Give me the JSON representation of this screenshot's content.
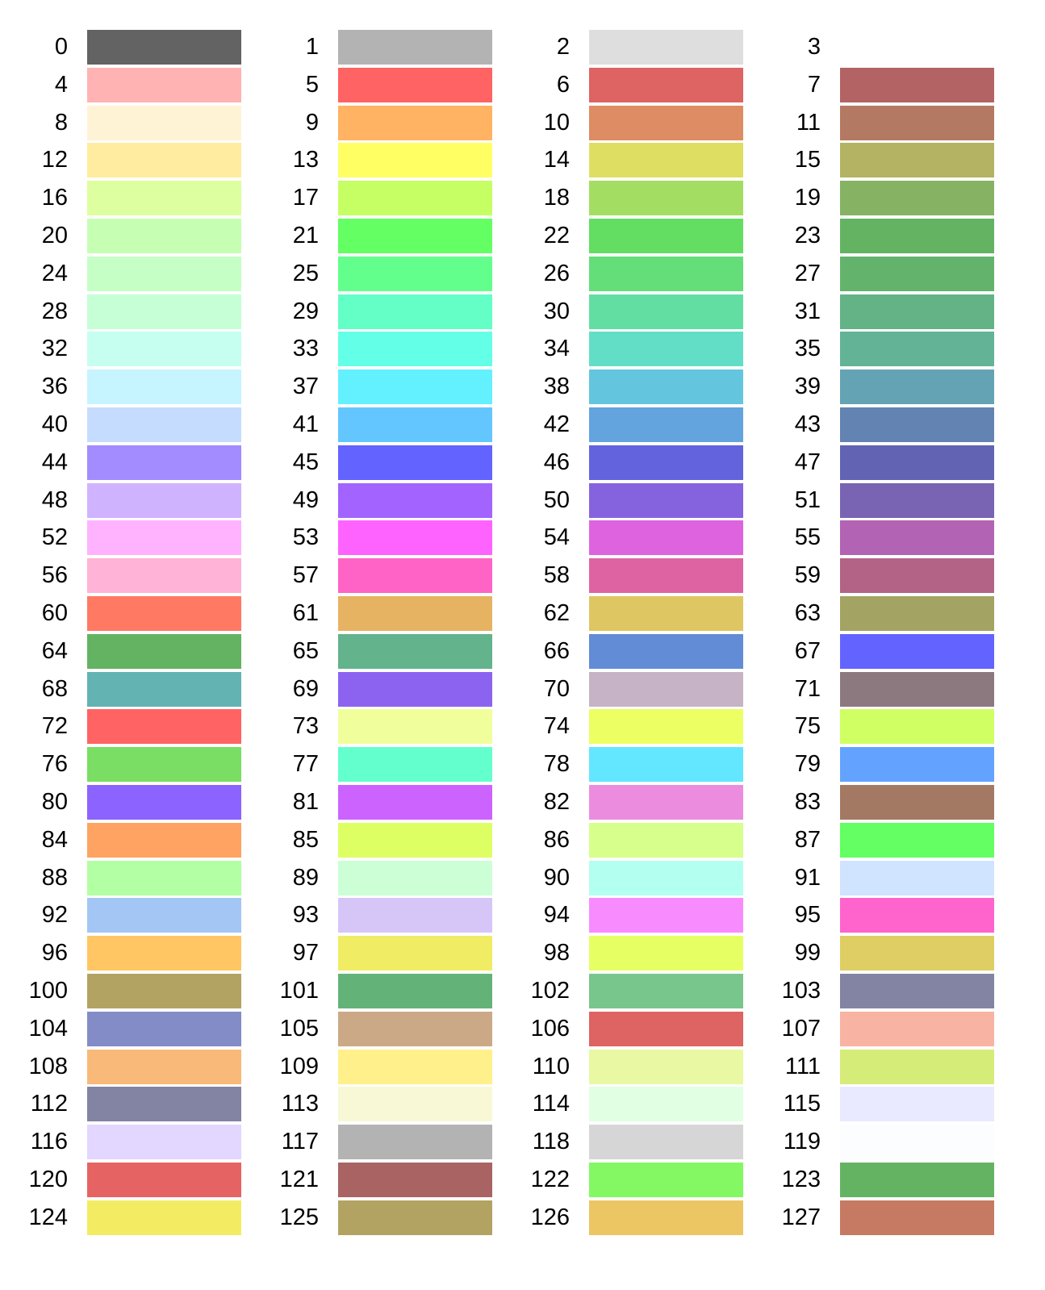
{
  "palette": [
    {
      "label": "0",
      "color": "#636363"
    },
    {
      "label": "1",
      "color": "#b3b3b3"
    },
    {
      "label": "2",
      "color": "#dedede"
    },
    {
      "label": "3",
      "color": "#ffffff"
    },
    {
      "label": "4",
      "color": "#ffb3b3"
    },
    {
      "label": "5",
      "color": "#ff6363"
    },
    {
      "label": "6",
      "color": "#de6363"
    },
    {
      "label": "7",
      "color": "#b36363"
    },
    {
      "label": "8",
      "color": "#fff3d6"
    },
    {
      "label": "9",
      "color": "#ffb363"
    },
    {
      "label": "10",
      "color": "#de8c63"
    },
    {
      "label": "11",
      "color": "#b37963"
    },
    {
      "label": "12",
      "color": "#ffeca0"
    },
    {
      "label": "13",
      "color": "#ffff63"
    },
    {
      "label": "14",
      "color": "#dede63"
    },
    {
      "label": "15",
      "color": "#b3b363"
    },
    {
      "label": "16",
      "color": "#deffa0"
    },
    {
      "label": "17",
      "color": "#c6ff63"
    },
    {
      "label": "18",
      "color": "#a3de63"
    },
    {
      "label": "19",
      "color": "#86b363"
    },
    {
      "label": "20",
      "color": "#c6ffb3"
    },
    {
      "label": "21",
      "color": "#63ff63"
    },
    {
      "label": "22",
      "color": "#63de63"
    },
    {
      "label": "23",
      "color": "#63b363"
    },
    {
      "label": "24",
      "color": "#c6ffc6"
    },
    {
      "label": "25",
      "color": "#63ff8c"
    },
    {
      "label": "26",
      "color": "#63de79"
    },
    {
      "label": "27",
      "color": "#63b36c"
    },
    {
      "label": "28",
      "color": "#c6ffd6"
    },
    {
      "label": "29",
      "color": "#63ffc6"
    },
    {
      "label": "30",
      "color": "#63dea3"
    },
    {
      "label": "31",
      "color": "#63b386"
    },
    {
      "label": "32",
      "color": "#c6fff0"
    },
    {
      "label": "33",
      "color": "#63ffe6"
    },
    {
      "label": "34",
      "color": "#63dec6"
    },
    {
      "label": "35",
      "color": "#63b396"
    },
    {
      "label": "36",
      "color": "#c6f4ff"
    },
    {
      "label": "37",
      "color": "#63f0ff"
    },
    {
      "label": "38",
      "color": "#63c6de"
    },
    {
      "label": "39",
      "color": "#63a3b3"
    },
    {
      "label": "40",
      "color": "#c6dcff"
    },
    {
      "label": "41",
      "color": "#63c6ff"
    },
    {
      "label": "42",
      "color": "#63a3de"
    },
    {
      "label": "43",
      "color": "#6383b3"
    },
    {
      "label": "44",
      "color": "#a38cff"
    },
    {
      "label": "45",
      "color": "#6363ff"
    },
    {
      "label": "46",
      "color": "#6363de"
    },
    {
      "label": "47",
      "color": "#6363b3"
    },
    {
      "label": "48",
      "color": "#d0b3ff"
    },
    {
      "label": "49",
      "color": "#a363ff"
    },
    {
      "label": "50",
      "color": "#8663de"
    },
    {
      "label": "51",
      "color": "#7963b3"
    },
    {
      "label": "52",
      "color": "#ffb3ff"
    },
    {
      "label": "53",
      "color": "#ff63ff"
    },
    {
      "label": "54",
      "color": "#de63de"
    },
    {
      "label": "55",
      "color": "#b363b3"
    },
    {
      "label": "56",
      "color": "#ffb3d6"
    },
    {
      "label": "57",
      "color": "#ff63c6"
    },
    {
      "label": "58",
      "color": "#de63a3"
    },
    {
      "label": "59",
      "color": "#b36386"
    },
    {
      "label": "60",
      "color": "#ff7963"
    },
    {
      "label": "61",
      "color": "#e6b363"
    },
    {
      "label": "62",
      "color": "#dec663"
    },
    {
      "label": "63",
      "color": "#a3a363"
    },
    {
      "label": "64",
      "color": "#63b363"
    },
    {
      "label": "65",
      "color": "#63b38c"
    },
    {
      "label": "66",
      "color": "#638cd6"
    },
    {
      "label": "67",
      "color": "#6363ff"
    },
    {
      "label": "68",
      "color": "#63b3b3"
    },
    {
      "label": "69",
      "color": "#8c63f0"
    },
    {
      "label": "70",
      "color": "#c6b3c6"
    },
    {
      "label": "71",
      "color": "#8c7980"
    },
    {
      "label": "72",
      "color": "#ff6363"
    },
    {
      "label": "73",
      "color": "#f0ff9c"
    },
    {
      "label": "74",
      "color": "#ecff63"
    },
    {
      "label": "75",
      "color": "#d0ff63"
    },
    {
      "label": "76",
      "color": "#79de63"
    },
    {
      "label": "77",
      "color": "#63ffcc"
    },
    {
      "label": "78",
      "color": "#63e6ff"
    },
    {
      "label": "79",
      "color": "#63a3ff"
    },
    {
      "label": "80",
      "color": "#8c63ff"
    },
    {
      "label": "81",
      "color": "#cc63ff"
    },
    {
      "label": "82",
      "color": "#ec8cde"
    },
    {
      "label": "83",
      "color": "#a37963"
    },
    {
      "label": "84",
      "color": "#ffa363"
    },
    {
      "label": "85",
      "color": "#deff63"
    },
    {
      "label": "86",
      "color": "#d6ff8c"
    },
    {
      "label": "87",
      "color": "#63ff63"
    },
    {
      "label": "88",
      "color": "#b3ffa3"
    },
    {
      "label": "89",
      "color": "#ccffd6"
    },
    {
      "label": "90",
      "color": "#b3fff0"
    },
    {
      "label": "91",
      "color": "#d0e3ff"
    },
    {
      "label": "92",
      "color": "#a3c6f4"
    },
    {
      "label": "93",
      "color": "#d6c6f8"
    },
    {
      "label": "94",
      "color": "#f88cff"
    },
    {
      "label": "95",
      "color": "#ff63cc"
    },
    {
      "label": "96",
      "color": "#ffc663"
    },
    {
      "label": "97",
      "color": "#f0ec63"
    },
    {
      "label": "98",
      "color": "#e6ff63"
    },
    {
      "label": "99",
      "color": "#dece63"
    },
    {
      "label": "100",
      "color": "#b3a363"
    },
    {
      "label": "101",
      "color": "#63b379"
    },
    {
      "label": "102",
      "color": "#79c68c"
    },
    {
      "label": "103",
      "color": "#8383a3"
    },
    {
      "label": "104",
      "color": "#838cc6"
    },
    {
      "label": "105",
      "color": "#cca986"
    },
    {
      "label": "106",
      "color": "#de6363"
    },
    {
      "label": "107",
      "color": "#f8b3a3"
    },
    {
      "label": "108",
      "color": "#f8b979"
    },
    {
      "label": "109",
      "color": "#fff08c"
    },
    {
      "label": "110",
      "color": "#e9f8a3"
    },
    {
      "label": "111",
      "color": "#d6ec79"
    },
    {
      "label": "112",
      "color": "#8383a3"
    },
    {
      "label": "113",
      "color": "#f8f8d6"
    },
    {
      "label": "114",
      "color": "#e0ffe3"
    },
    {
      "label": "115",
      "color": "#e9e9ff"
    },
    {
      "label": "116",
      "color": "#e3d6ff"
    },
    {
      "label": "117",
      "color": "#b3b3b3"
    },
    {
      "label": "118",
      "color": "#d6d6d6"
    },
    {
      "label": "119",
      "color": "#fbfdff"
    },
    {
      "label": "120",
      "color": "#e66363"
    },
    {
      "label": "121",
      "color": "#a96363"
    },
    {
      "label": "122",
      "color": "#83f863"
    },
    {
      "label": "123",
      "color": "#63b363"
    },
    {
      "label": "124",
      "color": "#f3ec63"
    },
    {
      "label": "125",
      "color": "#b3a363"
    },
    {
      "label": "126",
      "color": "#ecc663"
    },
    {
      "label": "127",
      "color": "#c67963"
    }
  ]
}
